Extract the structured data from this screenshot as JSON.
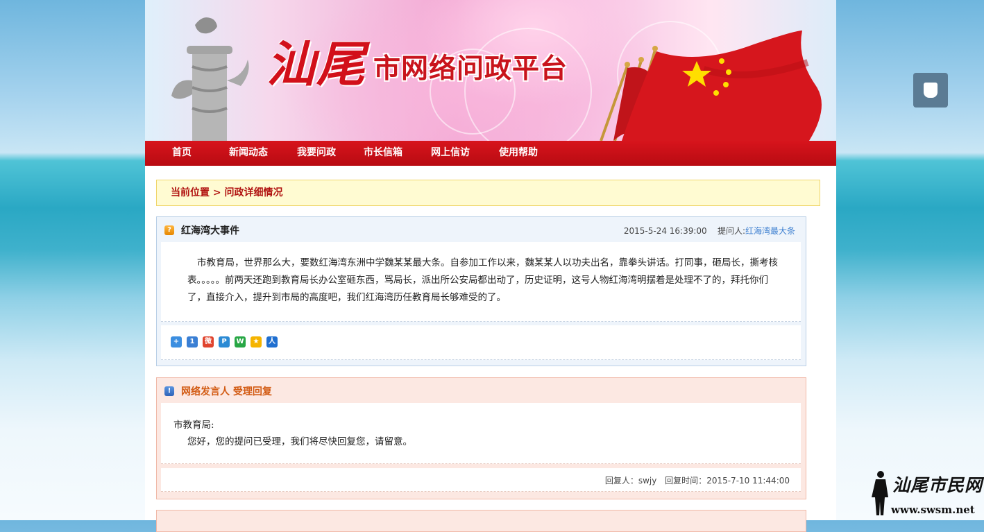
{
  "banner": {
    "title_calligraphy": "汕尾",
    "title_main": "市网络问政平台"
  },
  "nav": {
    "items": [
      "首页",
      "新闻动态",
      "我要问政",
      "市长信箱",
      "网上信访",
      "使用帮助"
    ]
  },
  "breadcrumb": {
    "text": "当前位置 > 问政详细情况"
  },
  "question": {
    "title": "红海湾大事件",
    "datetime": "2015-5-24 16:39:00",
    "asker_label": "提问人:",
    "asker": "红海湾最大条",
    "body": "市教育局，世界那么大，要数红海湾东洲中学魏某某最大条。自参加工作以来，魏某某人以功夫出名，靠拳头讲话。打同事，砸局长，撕考核表。。。。。前两天还跑到教育局长办公室砸东西，骂局长，派出所公安局都出动了，历史证明，这号人物红海湾明摆着是处理不了的，拜托你们了，直接介入，提升到市局的高度吧，我们红海湾历任教育局长够难受的了。",
    "share_icons": [
      "share-more-icon",
      "share-1-icon",
      "weibo-icon",
      "pengyou-icon",
      "wechat-icon",
      "qzone-icon",
      "renren-icon"
    ],
    "share_colors": [
      "#3b8ee0",
      "#3a7fd4",
      "#e0442e",
      "#2b8ad4",
      "#28a745",
      "#f5b400",
      "#1f6fd0"
    ]
  },
  "reply": {
    "title": "网络发言人 受理回复",
    "to": "市教育局:",
    "text": "您好，您的提问已受理，我们将尽快回复您，请留意。",
    "replier_label": "回复人：",
    "replier": "swjy",
    "time_label": "回复时间：",
    "time": "2015-7-10 11:44:00"
  },
  "watermark": {
    "calligraphy": "汕尾市民网",
    "url": "www.swsm.net"
  },
  "colors": {
    "nav_red": "#c8101a",
    "breadcrumb_bg": "#fffbd2",
    "question_bg": "#eef4fb",
    "reply_bg": "#fce8e2",
    "link_blue": "#3d7fd0",
    "reply_title": "#d25a12"
  }
}
